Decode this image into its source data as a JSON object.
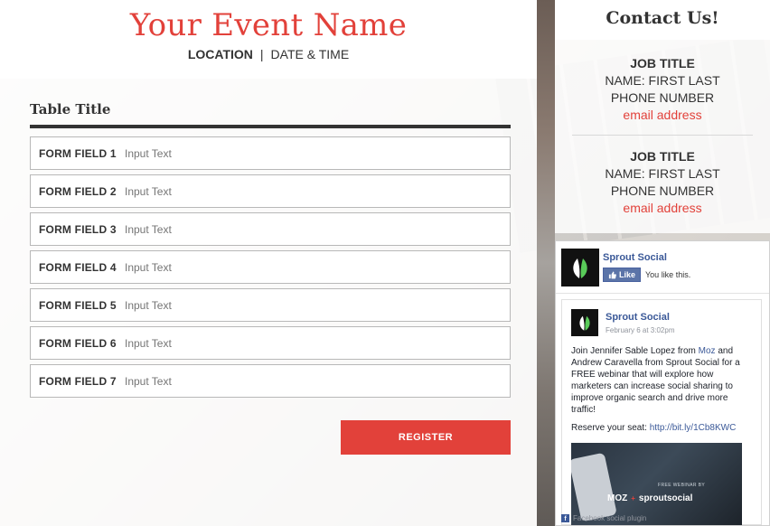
{
  "event": {
    "title": "Your Event Name",
    "location": "LOCATION",
    "separator": "|",
    "datetime": "DATE & TIME"
  },
  "form": {
    "table_title": "Table Title",
    "fields": [
      {
        "label": "FORM FIELD 1",
        "placeholder": "Input Text"
      },
      {
        "label": "FORM FIELD 2",
        "placeholder": "Input Text"
      },
      {
        "label": "FORM FIELD 3",
        "placeholder": "Input Text"
      },
      {
        "label": "FORM FIELD 4",
        "placeholder": "Input Text"
      },
      {
        "label": "FORM FIELD 5",
        "placeholder": "Input Text"
      },
      {
        "label": "FORM FIELD 6",
        "placeholder": "Input Text"
      },
      {
        "label": "FORM FIELD 7",
        "placeholder": "Input Text"
      }
    ],
    "register_label": "REGISTER"
  },
  "contact": {
    "heading": "Contact Us!",
    "people": [
      {
        "job": "JOB TITLE",
        "name": "NAME: FIRST LAST",
        "phone": "PHONE NUMBER",
        "email": "email address"
      },
      {
        "job": "JOB TITLE",
        "name": "NAME: FIRST LAST",
        "phone": "PHONE NUMBER",
        "email": "email address"
      }
    ]
  },
  "facebook": {
    "page_name": "Sprout Social",
    "like_label": "Like",
    "like_note": "You like this.",
    "post": {
      "author": "Sprout Social",
      "date": "February 6 at 3:02pm",
      "text_1": "Join Jennifer Sable Lopez from ",
      "link_1": "Moz",
      "text_2": " and Andrew Caravella from Sprout Social for a FREE webinar that will explore how marketers can increase social sharing to improve organic search and drive more traffic!",
      "reserve_text": "Reserve your seat: ",
      "reserve_link": "http://bit.ly/1Cb8KWC",
      "image_small_text": "FREE WEBINAR BY",
      "image_brand_1": "MOZ",
      "image_plus": "+",
      "image_brand_2": "sproutsocial"
    },
    "footer": "Facebook social plugin"
  },
  "colors": {
    "accent": "#e2413a",
    "facebook_blue": "#3b5998",
    "text": "#333333"
  },
  "icons": [
    "sprout-leaf-icon",
    "thumbs-up-icon",
    "facebook-icon"
  ]
}
